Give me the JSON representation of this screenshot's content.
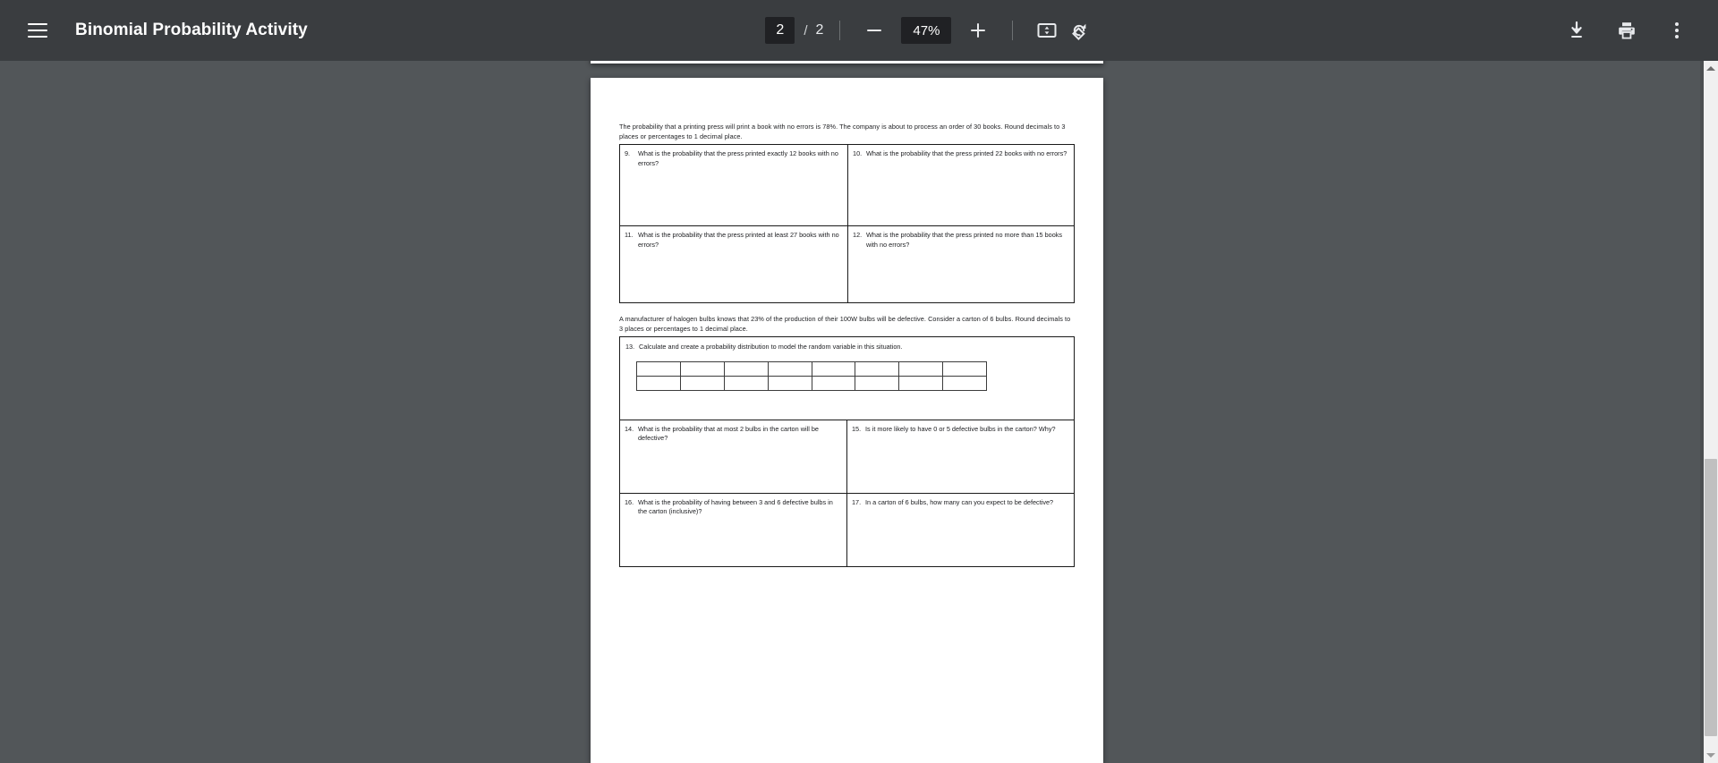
{
  "toolbar": {
    "menu_icon": "hamburger-menu-icon",
    "title": "Binomial Probability Activity",
    "page_current": "2",
    "page_separator": "/",
    "page_total": "2",
    "zoom_out_icon": "minus-icon",
    "zoom_level": "47%",
    "zoom_in_icon": "plus-icon",
    "fit_page_icon": "fit-to-page-icon",
    "rotate_icon": "rotate-clockwise-icon",
    "download_icon": "download-icon",
    "print_icon": "print-icon",
    "more_icon": "more-vertical-icon",
    "background_color": "#3a3d40",
    "field_background_color": "#202124",
    "text_color": "#ffffff"
  },
  "viewer": {
    "background_color": "#525659",
    "page_color": "#ffffff",
    "scrollbar": {
      "up_arrow_icon": "scroll-up-arrow-icon",
      "down_arrow_icon": "scroll-down-arrow-icon",
      "track_color": "#f0f0f0",
      "thumb_color": "#c0c0c0"
    }
  },
  "document": {
    "section_printing": {
      "intro": "The probability that a printing press will print a book with no errors is 78%. The company is about to process an order of 30 books. Round decimals to 3 places or percentages to 1 decimal place.",
      "questions": [
        {
          "number": "9.",
          "text": "What is the probability that the press printed exactly 12 books with no errors?"
        },
        {
          "number": "10.",
          "text": "What is the probability that the press printed 22 books with no errors?"
        },
        {
          "number": "11.",
          "text": "What is the probability that the press printed at least 27 books with no errors?"
        },
        {
          "number": "12.",
          "text": "What is the probability that the press printed no more than 15 books with no errors?"
        }
      ]
    },
    "section_bulbs": {
      "intro": "A manufacturer of halogen bulbs knows that 23% of the production of their 100W bulbs will be defective. Consider a carton of 6 bulbs. Round decimals to 3 places or percentages to 1 decimal place.",
      "q13": {
        "number": "13.",
        "text": "Calculate and create a probability distribution to model the random variable in this situation."
      },
      "distribution_table": {
        "columns": 8,
        "rows": [
          [
            "",
            "",
            "",
            "",
            "",
            "",
            "",
            ""
          ],
          [
            "",
            "",
            "",
            "",
            "",
            "",
            "",
            ""
          ]
        ]
      },
      "questions": [
        {
          "number": "14.",
          "text": "What is the probability that at most 2 bulbs in the carton will be defective?"
        },
        {
          "number": "15.",
          "text": "Is it more likely to have 0 or 5 defective bulbs in the carton? Why?"
        },
        {
          "number": "16.",
          "text": "What is the probability of having between 3 and 6 defective bulbs in the carton (inclusive)?"
        },
        {
          "number": "17.",
          "text": "In a carton of 6 bulbs, how many can you expect to be defective?"
        }
      ]
    }
  }
}
